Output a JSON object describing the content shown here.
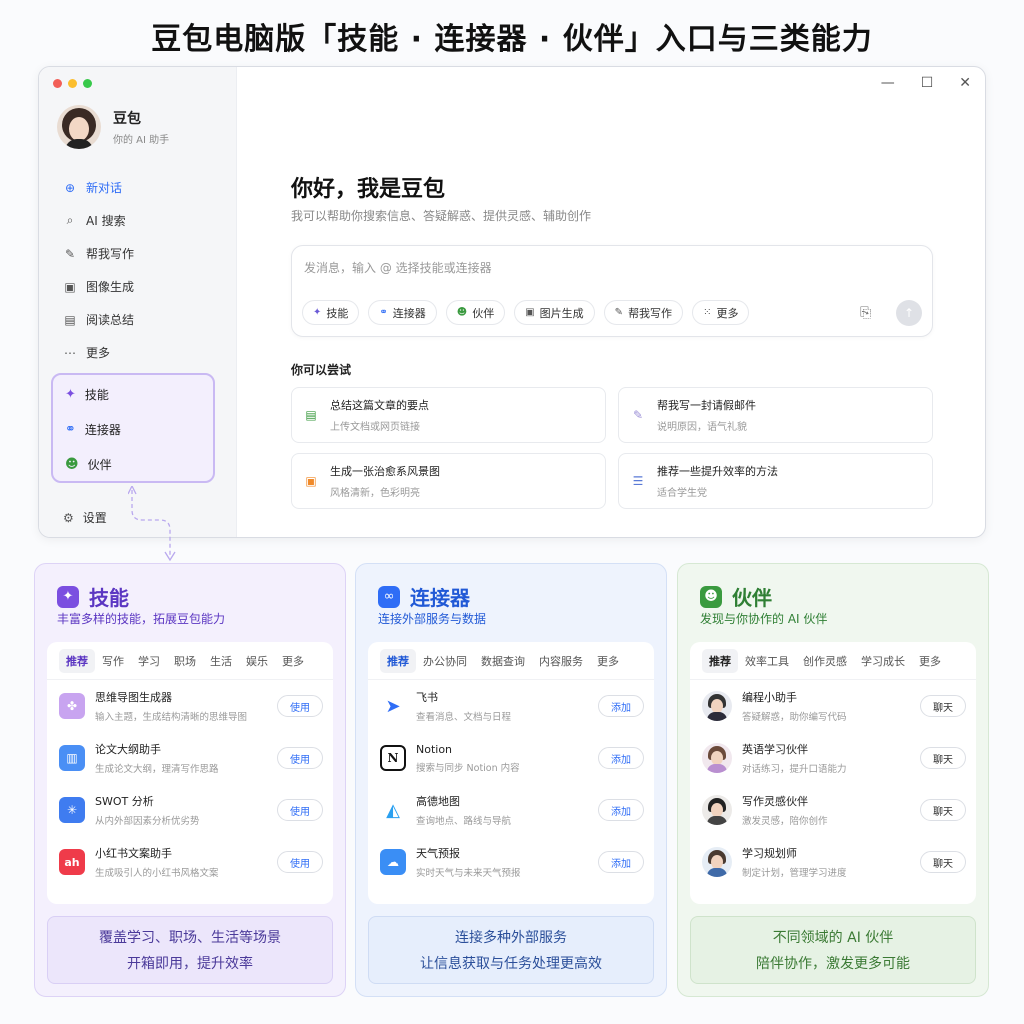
{
  "headline": "豆包电脑版「技能 · 连接器 · 伙伴」入口与三类能力",
  "app": {
    "window_controls": [
      "—",
      "☐",
      "✕"
    ],
    "profile": {
      "name": "豆包",
      "subtitle": "你的 AI 助手"
    },
    "nav": [
      {
        "label": "新对话",
        "icon": "plus-circle-icon",
        "active": true
      },
      {
        "label": "AI 搜索",
        "icon": "search-icon"
      },
      {
        "label": "帮我写作",
        "icon": "pen-icon"
      },
      {
        "label": "图像生成",
        "icon": "image-icon"
      },
      {
        "label": "阅读总结",
        "icon": "book-icon"
      },
      {
        "label": "更多",
        "icon": "more-icon"
      }
    ],
    "highlight_nav": [
      {
        "label": "技能",
        "icon": "sparkle-icon"
      },
      {
        "label": "连接器",
        "icon": "link-icon"
      },
      {
        "label": "伙伴",
        "icon": "people-icon"
      }
    ],
    "settings_label": "设置",
    "greeting": "你好，我是豆包",
    "greeting_sub": "我可以帮助你搜索信息、答疑解惑、提供灵感、辅助创作",
    "composer_placeholder": "发消息，输入 @ 选择技能或连接器",
    "composer_chips": [
      "技能",
      "连接器",
      "伙伴",
      "图片生成",
      "帮我写作",
      "更多"
    ],
    "try_title": "你可以尝试",
    "suggestions": [
      {
        "title": "总结这篇文章的要点",
        "sub": "上传文档或网页链接"
      },
      {
        "title": "帮我写一封请假邮件",
        "sub": "说明原因，语气礼貌"
      },
      {
        "title": "生成一张治愈系风景图",
        "sub": "风格清新，色彩明亮"
      },
      {
        "title": "推荐一些提升效率的方法",
        "sub": "适合学生党"
      }
    ]
  },
  "panels": {
    "skills": {
      "title": "技能",
      "subtitle": "丰富多样的技能，拓展豆包能力",
      "accent": "#7b4fe0",
      "tabs": [
        "推荐",
        "写作",
        "学习",
        "职场",
        "生活",
        "娱乐",
        "更多"
      ],
      "items": [
        {
          "name": "思维导图生成器",
          "desc": "输入主题，生成结构清晰的思维导图",
          "button": "使用",
          "color": "#c8a4f0"
        },
        {
          "name": "论文大纲助手",
          "desc": "生成论文大纲，理清写作思路",
          "button": "使用",
          "color": "#4a8ff5"
        },
        {
          "name": "SWOT 分析",
          "desc": "从内外部因素分析优劣势",
          "button": "使用",
          "color": "#3f7cf0"
        },
        {
          "name": "小红书文案助手",
          "desc": "生成吸引人的小红书风格文案",
          "button": "使用",
          "color": "#ef3b4a"
        }
      ],
      "footer": [
        "覆盖学习、职场、生活等场景",
        "开箱即用，提升效率"
      ]
    },
    "connectors": {
      "title": "连接器",
      "subtitle": "连接外部服务与数据",
      "accent": "#2f6df6",
      "tabs": [
        "推荐",
        "办公协同",
        "数据查询",
        "内容服务",
        "更多"
      ],
      "items": [
        {
          "name": "飞书",
          "desc": "查看消息、文档与日程",
          "button": "添加",
          "color": "#2f6df6"
        },
        {
          "name": "Notion",
          "desc": "搜索与同步 Notion 内容",
          "button": "添加",
          "color": "#111111"
        },
        {
          "name": "高德地图",
          "desc": "查询地点、路线与导航",
          "button": "添加",
          "color": "#2aa0f0"
        },
        {
          "name": "天气预报",
          "desc": "实时天气与未来天气预报",
          "button": "添加",
          "color": "#3a8ef5"
        }
      ],
      "footer": [
        "连接多种外部服务",
        "让信息获取与任务处理更高效"
      ]
    },
    "partners": {
      "title": "伙伴",
      "subtitle": "发现与你协作的 AI 伙伴",
      "accent": "#3a9a3f",
      "tabs": [
        "推荐",
        "效率工具",
        "创作灵感",
        "学习成长",
        "更多"
      ],
      "items": [
        {
          "name": "编程小助手",
          "desc": "答疑解惑，助你编写代码",
          "button": "聊天",
          "color": "#2c2c3a"
        },
        {
          "name": "英语学习伙伴",
          "desc": "对话练习，提升口语能力",
          "button": "聊天",
          "color": "#b98fd0"
        },
        {
          "name": "写作灵感伙伴",
          "desc": "激发灵感，陪你创作",
          "button": "聊天",
          "color": "#444444"
        },
        {
          "name": "学习规划师",
          "desc": "制定计划，管理学习进度",
          "button": "聊天",
          "color": "#3f6aa8"
        }
      ],
      "footer": [
        "不同领域的 AI 伙伴",
        "陪伴协作，激发更多可能"
      ]
    }
  }
}
